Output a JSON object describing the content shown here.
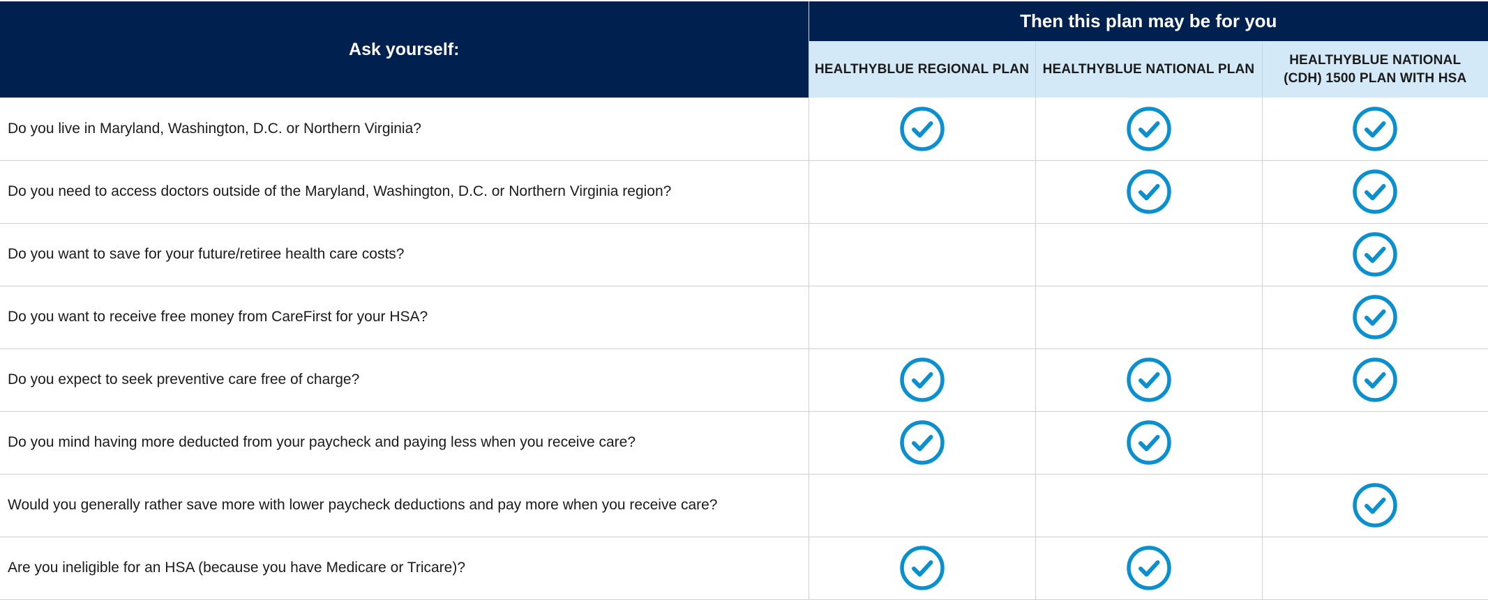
{
  "header": {
    "ask_label": "Ask yourself:",
    "then_label": "Then this plan may be for you",
    "plans": [
      "HEALTHYBLUE REGIONAL PLAN",
      "HEALTHYBLUE NATIONAL PLAN",
      "HEALTHYBLUE NATIONAL (CDH) 1500 PLAN WITH HSA"
    ]
  },
  "rows": [
    {
      "question": "Do you live in Maryland, Washington, D.C. or Northern Virginia?",
      "checks": [
        true,
        true,
        true
      ]
    },
    {
      "question": "Do you need to access doctors outside of the Maryland, Washington, D.C. or Northern Virginia region?",
      "checks": [
        false,
        true,
        true
      ]
    },
    {
      "question": "Do you want to save for your future/retiree health care costs?",
      "checks": [
        false,
        false,
        true
      ]
    },
    {
      "question": "Do you want to receive free money from CareFirst for your HSA?",
      "checks": [
        false,
        false,
        true
      ]
    },
    {
      "question": "Do you expect to seek preventive care free of charge?",
      "checks": [
        true,
        true,
        true
      ]
    },
    {
      "question": "Do you mind having more deducted from your paycheck and paying less when you receive care?",
      "checks": [
        true,
        true,
        false
      ]
    },
    {
      "question": "Would you generally rather save more with lower paycheck deductions and pay more when you receive care?",
      "checks": [
        false,
        false,
        true
      ]
    },
    {
      "question": "Are you ineligible for an HSA (because you have Medicare or Tricare)?",
      "checks": [
        true,
        true,
        false
      ]
    }
  ],
  "colors": {
    "header_navy": "#002150",
    "plan_header_bg": "#d4e9f7",
    "check_blue": "#0a8fcf"
  },
  "icons": {
    "check": "check-circle-icon"
  }
}
